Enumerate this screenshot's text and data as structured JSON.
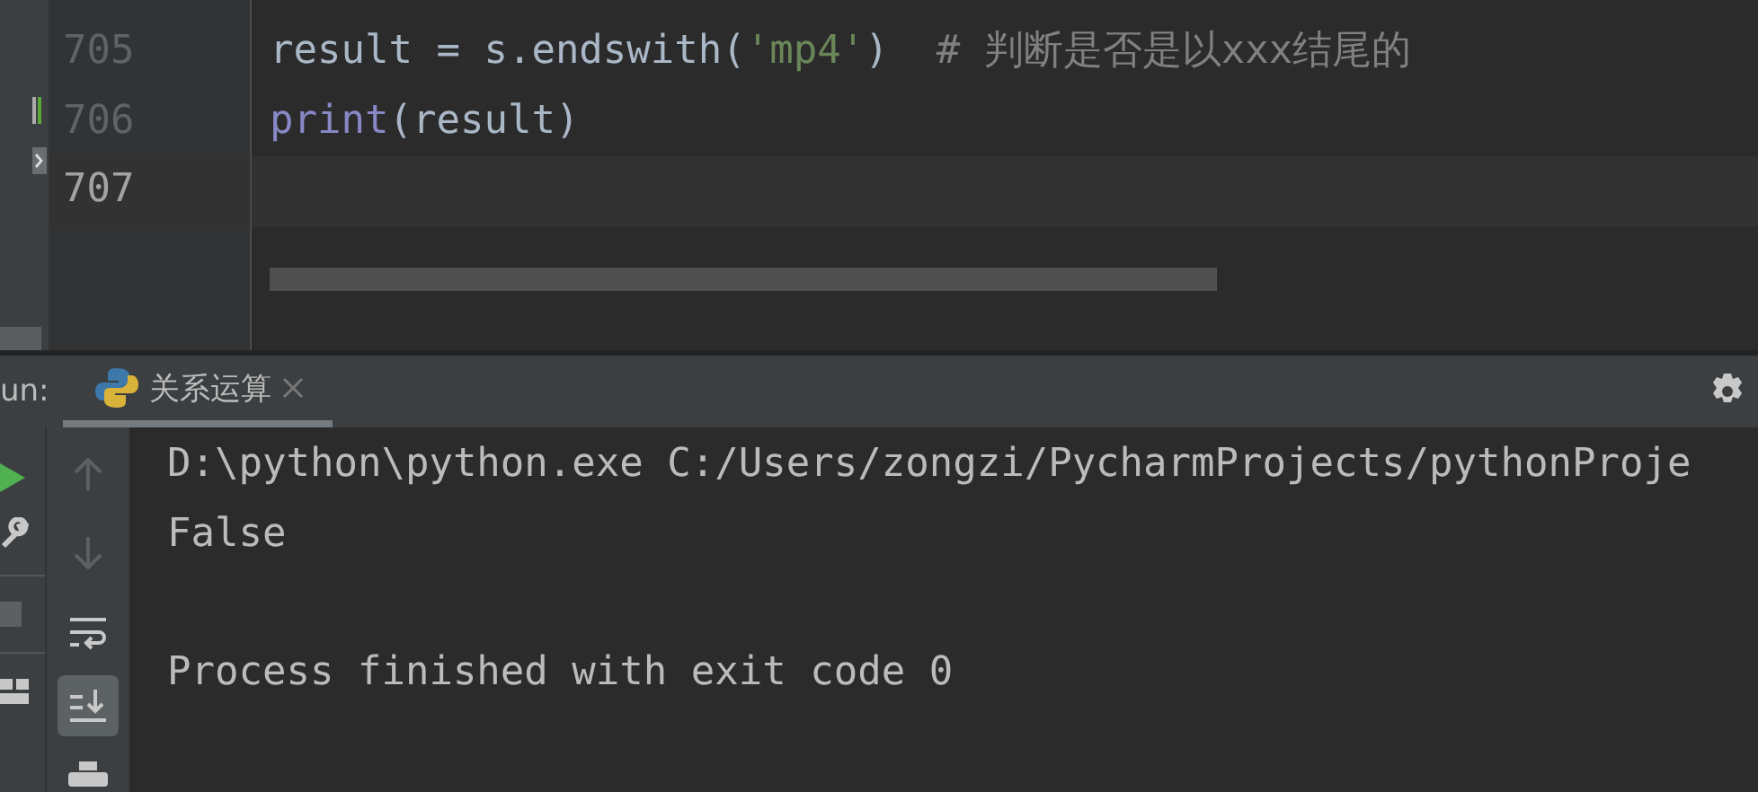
{
  "editor": {
    "lines": [
      {
        "number": "705",
        "current": false,
        "tokens": [
          {
            "text": "result = s.endswith(",
            "kind": "plain"
          },
          {
            "text": "'mp4'",
            "kind": "string"
          },
          {
            "text": ")  ",
            "kind": "plain"
          },
          {
            "text": "# 判断是否是以xxx结尾的",
            "kind": "comment"
          }
        ]
      },
      {
        "number": "706",
        "current": false,
        "tokens": [
          {
            "text": "print",
            "kind": "builtin"
          },
          {
            "text": "(result)",
            "kind": "plain"
          }
        ]
      },
      {
        "number": "707",
        "current": true
      }
    ]
  },
  "run_panel": {
    "label": "un:",
    "tabs": [
      {
        "label": "关系运算",
        "selected": true
      }
    ],
    "console": [
      {
        "text": "D:\\python\\python.exe C:/Users/zongzi/PycharmProjects/pythonProje",
        "blank_before": false
      },
      {
        "text": "False",
        "blank_before": false
      },
      {
        "text": "Process finished with exit code 0",
        "blank_before": true
      }
    ]
  }
}
